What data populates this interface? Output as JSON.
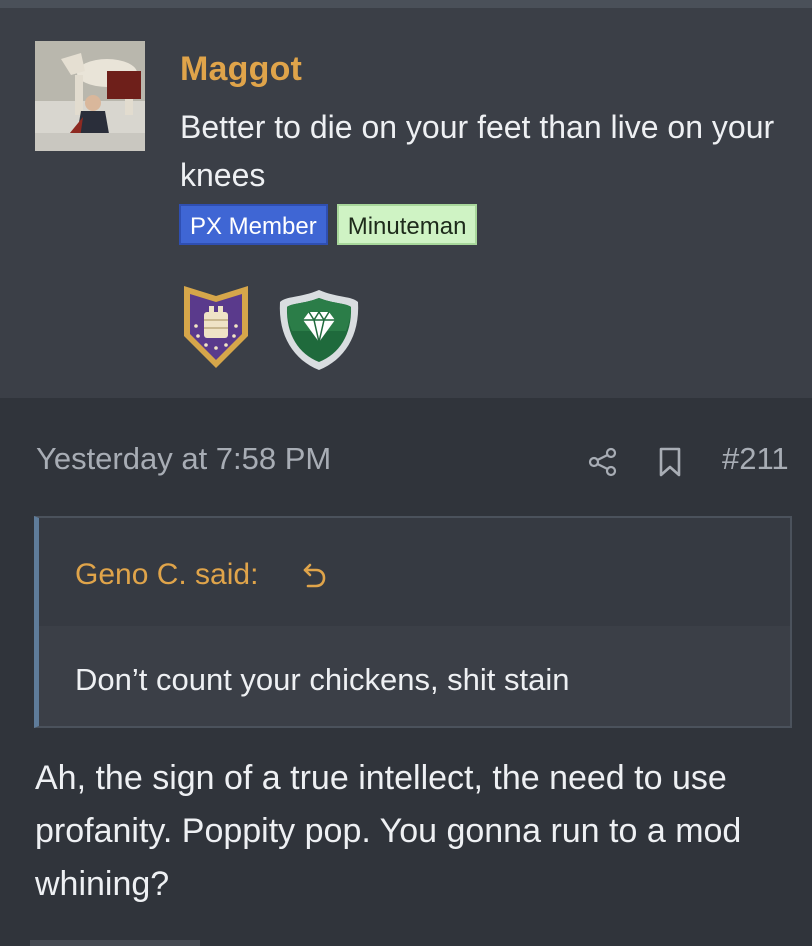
{
  "user": {
    "name": "Maggot",
    "title": "Better to die on your feet than live on your knees",
    "badges": [
      "PX Member",
      "Minuteman"
    ],
    "trophies": [
      "armor-vest-shield-icon",
      "diamond-shield-icon"
    ]
  },
  "post": {
    "date": "Yesterday at 7:58 PM",
    "number": "#211",
    "quote": {
      "author_label": "Geno C. said:",
      "text": "Don’t count your chickens, shit stain"
    },
    "body": "Ah, the sign of a true intellect, the need to use profanity. Poppity pop. You gonna run to a mod whining?"
  },
  "icons": {
    "share": "share-icon",
    "bookmark": "bookmark-icon",
    "quote_jump": "jump-to-quote-icon"
  },
  "colors": {
    "accent": "#e0a44a",
    "panel": "#3b3f47",
    "background": "#30343b",
    "px_badge": "#3f66d4",
    "minuteman_badge": "#cff3c4"
  }
}
